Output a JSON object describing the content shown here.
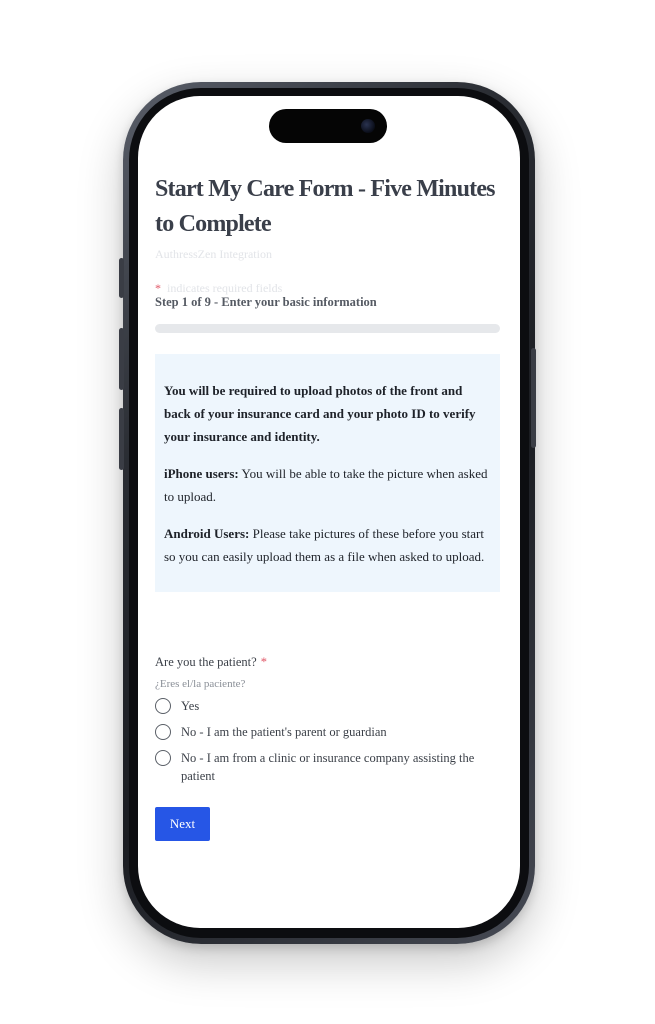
{
  "form": {
    "title": "Start My Care Form - Five Minutes to Complete",
    "subtitle": "AuthressZen Integration",
    "required_note": "indicates required fields",
    "required_star": "*",
    "step_text": "Step 1 of 9 - Enter your basic information",
    "progress_fraction": 0.0
  },
  "info": {
    "lead": "You will be required to upload photos of the front and back of your insurance card and your photo ID to verify your insurance and identity.",
    "iphone_label": "iPhone users:",
    "iphone_text": " You will be able to take the picture when asked to upload.",
    "android_label": "Android Users:",
    "android_text": " Please take pictures of these before you start so you can easily upload them as a file when asked to upload."
  },
  "question": {
    "label": "Are you the patient?",
    "required_star": "*",
    "translation": "¿Eres el/la paciente?",
    "options": [
      "Yes",
      "No - I am the patient's parent or guardian",
      "No - I am from a clinic or insurance company assisting the patient"
    ]
  },
  "actions": {
    "next_label": "Next"
  },
  "colors": {
    "accent": "#2656e6",
    "required": "#e05565",
    "info_bg": "#eef6fd"
  }
}
